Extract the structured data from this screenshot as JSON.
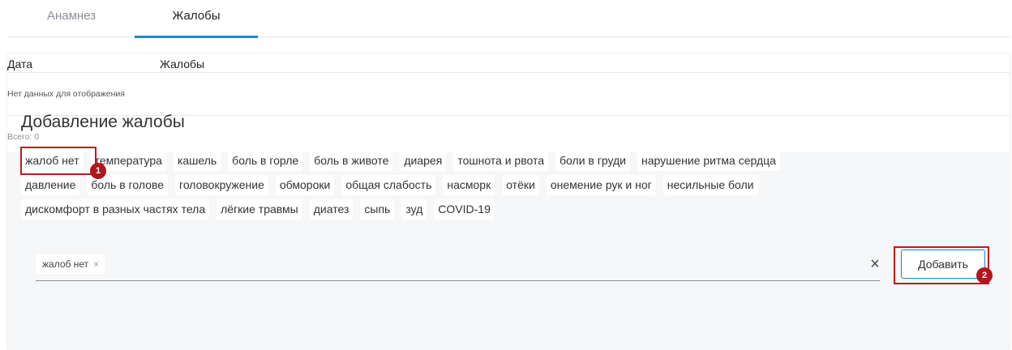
{
  "tabs": [
    {
      "label": "Анамнез",
      "active": false
    },
    {
      "label": "Жалобы",
      "active": true
    }
  ],
  "table": {
    "columns": [
      "Дата",
      "Жалобы"
    ],
    "empty_text": "Нет данных для отображения",
    "total_text": "Всего: 0"
  },
  "add_section": {
    "title": "Добавление жалобы",
    "chip_rows": [
      [
        "жалоб нет",
        "температура",
        "кашель",
        "боль в горле",
        "боль в животе",
        "диарея",
        "тошнота и рвота",
        "боли в груди",
        "нарушение ритма сердца"
      ],
      [
        "давление",
        "боль в голове",
        "головокружение",
        "обмороки",
        "общая слабость",
        "насморк",
        "отёки",
        "онемение рук и ног",
        "несильные боли"
      ],
      [
        "дискомфорт в разных частях тела",
        "лёгкие травмы",
        "диатез",
        "сыпь",
        "зуд",
        "COVID-19"
      ]
    ],
    "selected_tag": "жалоб нет",
    "tag_remove_icon": "×",
    "clear_icon": "×",
    "add_button": "Добавить"
  },
  "annotations": {
    "badge1": "1",
    "badge2": "2",
    "marker_color": "#c0191f"
  },
  "colors": {
    "accent": "#1e88c8",
    "panel_bg": "#f6f7f8"
  }
}
